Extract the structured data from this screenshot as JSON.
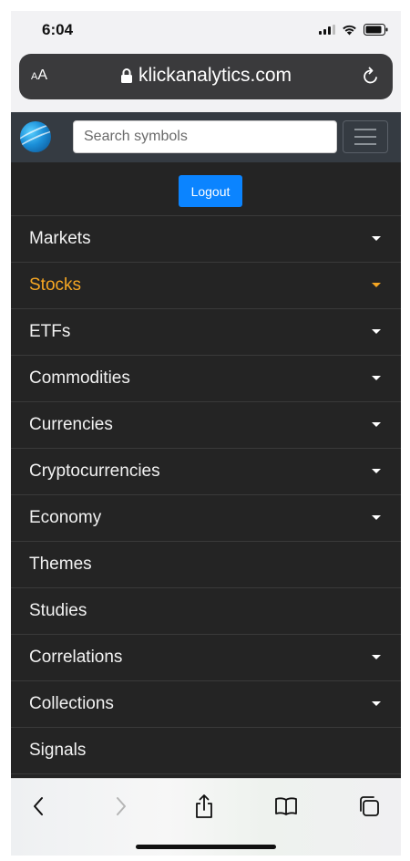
{
  "status_bar": {
    "time": "6:04"
  },
  "browser": {
    "aa_label": "AA",
    "url": "klickanalytics.com"
  },
  "header": {
    "search_placeholder": "Search symbols"
  },
  "nav": {
    "logout_label": "Logout",
    "items": [
      {
        "label": "Markets",
        "dropdown": true,
        "active": false
      },
      {
        "label": "Stocks",
        "dropdown": true,
        "active": true
      },
      {
        "label": "ETFs",
        "dropdown": true,
        "active": false
      },
      {
        "label": "Commodities",
        "dropdown": true,
        "active": false
      },
      {
        "label": "Currencies",
        "dropdown": true,
        "active": false
      },
      {
        "label": "Cryptocurrencies",
        "dropdown": true,
        "active": false
      },
      {
        "label": "Economy",
        "dropdown": true,
        "active": false
      },
      {
        "label": "Themes",
        "dropdown": false,
        "active": false
      },
      {
        "label": "Studies",
        "dropdown": false,
        "active": false
      },
      {
        "label": "Correlations",
        "dropdown": true,
        "active": false
      },
      {
        "label": "Collections",
        "dropdown": true,
        "active": false
      },
      {
        "label": "Signals",
        "dropdown": false,
        "active": false
      }
    ]
  },
  "colors": {
    "active_item": "#f5a623",
    "logout_button": "#0b84ff",
    "nav_background": "#242424",
    "header_background": "#353b42"
  },
  "toolbar_icons": [
    "back-icon",
    "forward-icon",
    "share-icon",
    "bookmarks-icon",
    "tabs-icon"
  ]
}
